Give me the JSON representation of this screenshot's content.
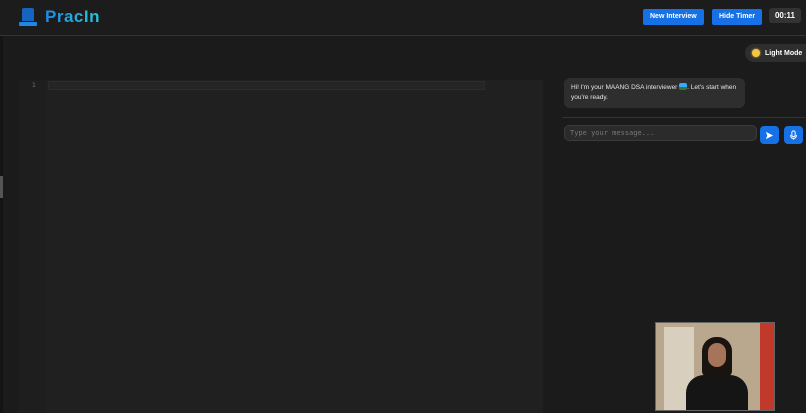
{
  "header": {
    "app_name": "PracIn",
    "logo_icon": "laptop-icon",
    "new_interview_label": "New Interview",
    "hide_timer_label": "Hide Timer",
    "timer": "00:11"
  },
  "theme": {
    "toggle_label": "Light Mode",
    "icon": "sun-icon"
  },
  "editor": {
    "line_numbers": [
      "1"
    ]
  },
  "chat": {
    "messages": [
      {
        "sender": "interviewer",
        "text_before_icon": "Hi! I'm your MAANG DSA interviewer",
        "icon": "technologist-icon",
        "text_after_icon": ". Let's start when you're ready."
      }
    ],
    "input_placeholder": "Type your message...",
    "send_icon": "send-icon",
    "mic_icon": "microphone-icon"
  },
  "colors": {
    "accent": "#1671e6",
    "background": "#1b1b1b",
    "editor_bg": "#202020",
    "bubble_bg": "#2e2e2e"
  }
}
